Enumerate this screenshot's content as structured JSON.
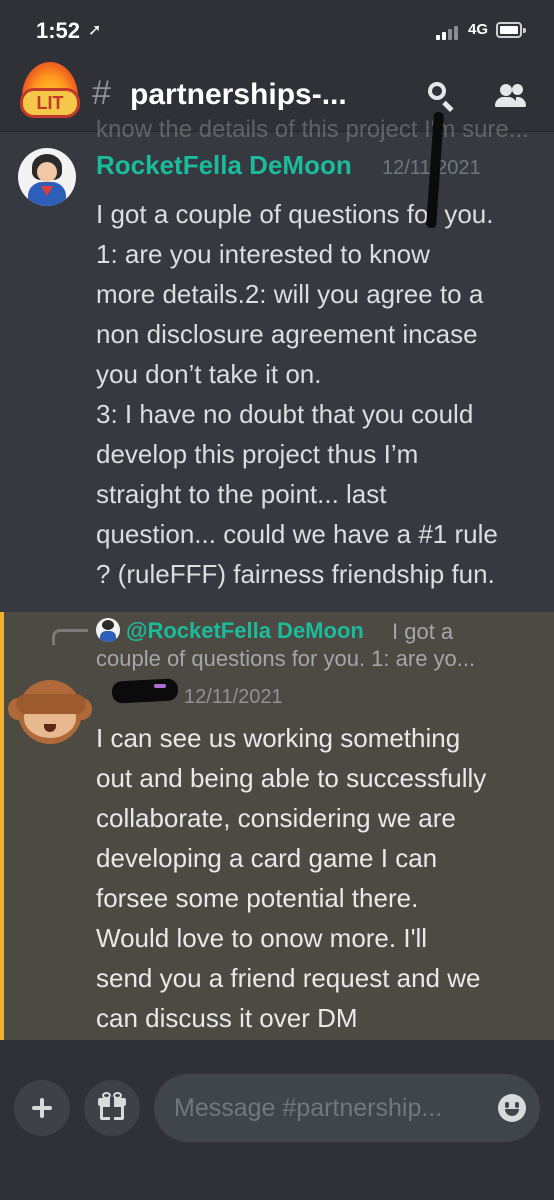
{
  "status_bar": {
    "time": "1:52",
    "location_arrow": "➚",
    "network": "4G"
  },
  "header": {
    "server_icon_text": "LIT",
    "hash": "#",
    "channel_name": "partnerships-...",
    "icons": [
      "search-icon",
      "members-icon"
    ]
  },
  "partial_text": "know the details of this project I'm sure...",
  "message1": {
    "author": "RocketFella DeMoon",
    "timestamp": "12/11/2021",
    "lines": [
      "I got a couple of questions for you.",
      "1: are you interested to know",
      "more details.2: will you agree to a",
      "non disclosure agreement incase",
      "you don’t take it on.",
      "3: I have no doubt that you could",
      "develop this project thus I’m",
      "straight to the point... last",
      "question... could we have a #1 rule",
      "? (ruleFFF) fairness friendship fun."
    ]
  },
  "message2": {
    "reply_author": "@RocketFella DeMoon",
    "reply_snippet_1": "I got a",
    "reply_snippet_2": "couple of questions for you.  1: are yo...",
    "timestamp": "12/11/2021",
    "lines": [
      "I can see us working something",
      "out and being able to successfully",
      "collaborate, considering we are",
      "developing a card game I can",
      "forsee some potential there.",
      "Would love to onow more. I'll",
      "send you a friend request and we",
      "can discuss it over DM"
    ]
  },
  "composer": {
    "placeholder": "Message #partnership..."
  },
  "colors": {
    "background": "#36393f",
    "header": "#2f3136",
    "author_teal": "#1abc9c",
    "highlight_border": "#f0b232"
  }
}
